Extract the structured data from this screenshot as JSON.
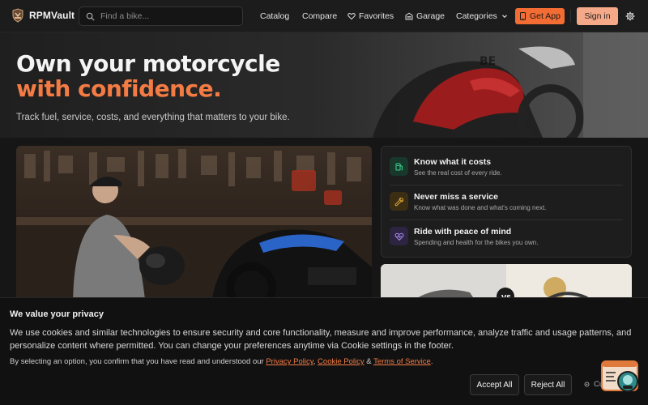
{
  "header": {
    "brand": "RPMVault",
    "search_placeholder": "Find a bike...",
    "nav": {
      "catalog": "Catalog",
      "compare": "Compare",
      "favorites": "Favorites",
      "garage": "Garage",
      "categories": "Categories"
    },
    "get_app": "Get App",
    "sign_in": "Sign in",
    "icons": [
      "logo-shield-icon",
      "search-icon",
      "heart-icon",
      "garage-icon",
      "chevron-down-icon",
      "phone-icon",
      "gear-icon"
    ]
  },
  "hero": {
    "title_line1": "Own your motorcycle",
    "title_line2": "with confidence.",
    "subtitle": "Track fuel, service, costs, and everything that matters to your bike."
  },
  "features": [
    {
      "title": "Know what it costs",
      "desc": "See the real cost of every ride.",
      "icon": "fuel-icon",
      "color": "#2f9e6a"
    },
    {
      "title": "Never miss a service",
      "desc": "Know what was done and what's coming next.",
      "icon": "wrench-icon",
      "color": "#d79b2a"
    },
    {
      "title": "Ride with peace of mind",
      "desc": "Spending and health for the bikes you own.",
      "icon": "heart-pulse-icon",
      "color": "#8f6bd6"
    }
  ],
  "cookie": {
    "title": "We value your privacy",
    "body": "We use cookies and similar technologies to ensure security and core functionality, measure and improve performance, analyze traffic and usage patterns, and personalize content where permitted. You can change your preferences anytime via Cookie settings in the footer.",
    "note_prefix": "By selecting an option, you confirm that you have read and understood our ",
    "privacy_link": "Privacy Policy",
    "sep1": ", ",
    "cookie_link": "Cookie Policy",
    "sep2": " & ",
    "terms_link": "Terms of Service",
    "note_suffix": ".",
    "accept_all": "Accept All",
    "reject_all": "Reject All",
    "customize": "Custo"
  },
  "colors": {
    "accent": "#f36c34",
    "accent_text": "#f47c44",
    "sign_in_bg": "#f6a989",
    "background": "#161616"
  }
}
